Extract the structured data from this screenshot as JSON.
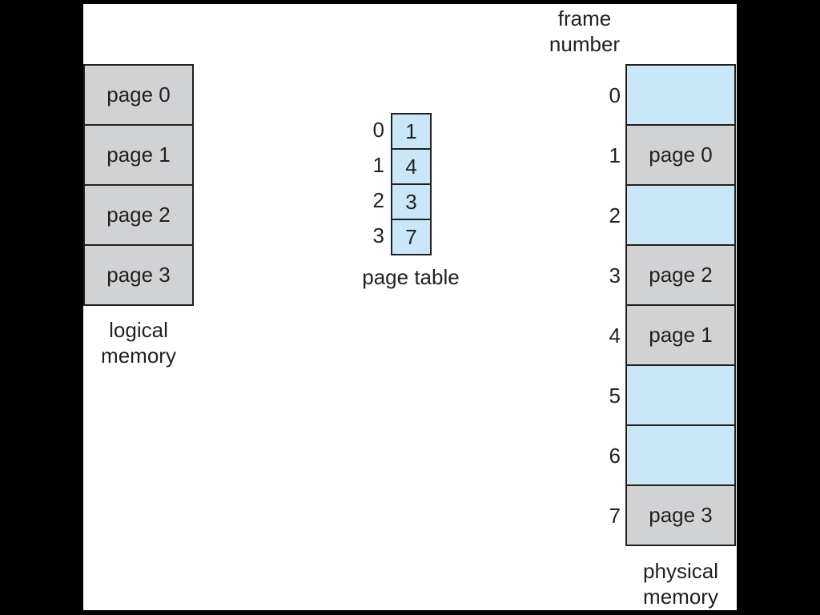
{
  "logical_memory": {
    "label_line1": "logical",
    "label_line2": "memory",
    "pages": [
      "page 0",
      "page 1",
      "page 2",
      "page 3"
    ]
  },
  "page_table": {
    "label": "page table",
    "indices": [
      "0",
      "1",
      "2",
      "3"
    ],
    "frames": [
      "1",
      "4",
      "3",
      "7"
    ]
  },
  "physical_memory": {
    "header_line1": "frame",
    "header_line2": "number",
    "label_line1": "physical",
    "label_line2": "memory",
    "frame_numbers": [
      "0",
      "1",
      "2",
      "3",
      "4",
      "5",
      "6",
      "7"
    ],
    "frames": [
      "",
      "page 0",
      "",
      "page 2",
      "page 1",
      "",
      "",
      "page 3"
    ]
  },
  "colors": {
    "occupied": "#d1d2d4",
    "free": "#c9e7f8",
    "page_table_cell": "#c9e7f8",
    "background": "#000000"
  }
}
